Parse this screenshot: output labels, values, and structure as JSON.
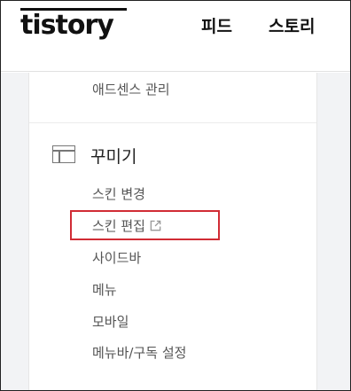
{
  "header": {
    "logo": "tistory",
    "nav": [
      "피드",
      "스토리"
    ]
  },
  "menu": {
    "prev_item": "애드센스 관리",
    "section": {
      "title": "꾸미기",
      "icon": "layout-icon",
      "items": [
        {
          "label": "스킨 변경"
        },
        {
          "label": "스킨 편집",
          "external": true,
          "highlighted": true
        },
        {
          "label": "사이드바"
        },
        {
          "label": "메뉴"
        },
        {
          "label": "모바일"
        },
        {
          "label": "메뉴바/구독 설정"
        }
      ]
    }
  },
  "colors": {
    "highlight": "#d12c35",
    "background": "#f2f3f5"
  }
}
